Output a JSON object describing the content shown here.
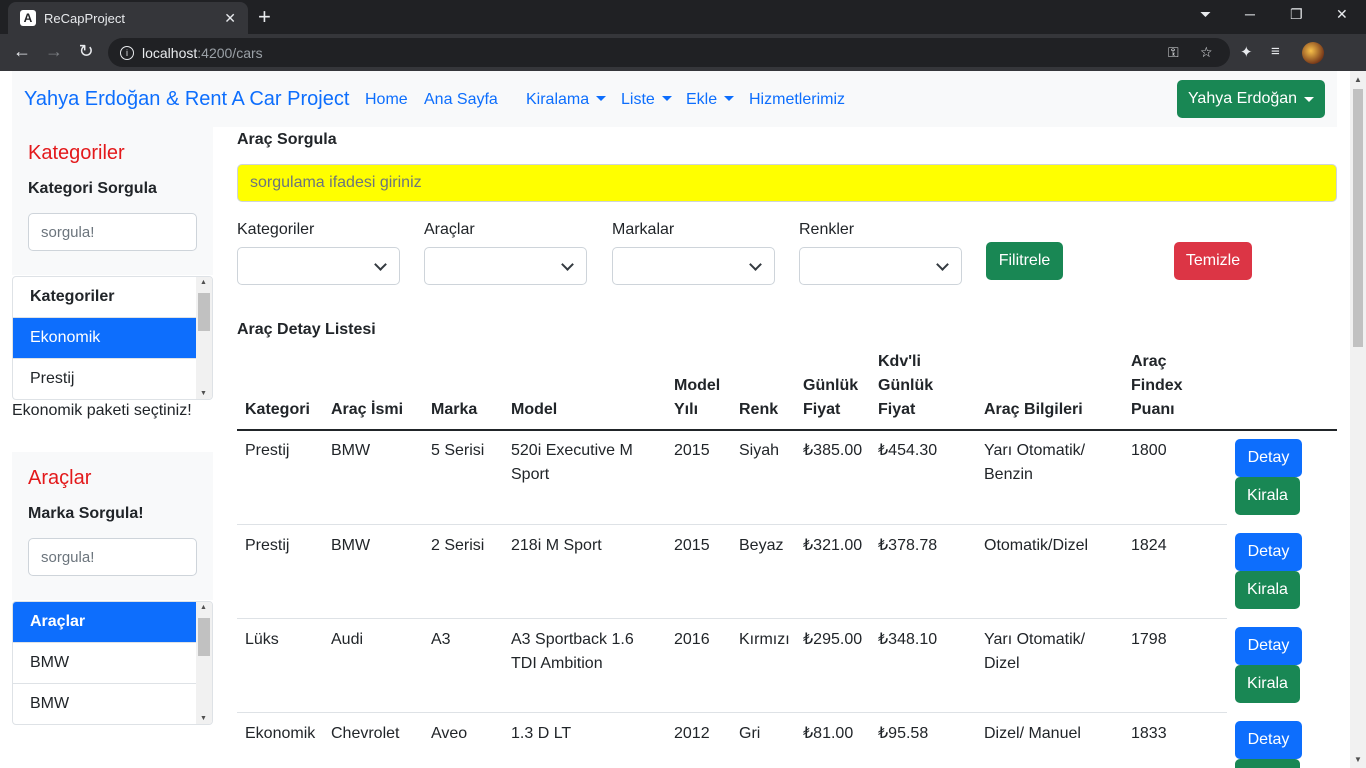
{
  "browser": {
    "tab_title": "ReCapProject",
    "url_host": "localhost",
    "url_path": ":4200/cars"
  },
  "navbar": {
    "brand": "Yahya Erdoğan & Rent A Car Project",
    "links": [
      "Home",
      "Ana Sayfa",
      "Kiralama",
      "Liste",
      "Ekle",
      "Hizmetlerimiz"
    ],
    "user_button": "Yahya Erdoğan"
  },
  "sidebar": {
    "categories": {
      "title": "Kategoriler",
      "search_label": "Kategori Sorgula",
      "search_placeholder": "sorgula!",
      "list_header": "Kategoriler",
      "items": [
        "Ekonomik",
        "Prestij"
      ],
      "selected_message": "Ekonomik paketi seçtiniz!"
    },
    "cars": {
      "title": "Araçlar",
      "search_label": "Marka Sorgula!",
      "search_placeholder": "sorgula!",
      "list_header": "Araçlar",
      "items": [
        "BMW",
        "BMW"
      ]
    }
  },
  "main": {
    "query_label": "Araç Sorgula",
    "query_placeholder": "sorgulama ifadesi giriniz",
    "filters": {
      "labels": [
        "Kategoriler",
        "Araçlar",
        "Markalar",
        "Renkler"
      ],
      "filter_button": "Filitrele",
      "clear_button": "Temizle"
    },
    "list_title": "Araç Detay Listesi",
    "table": {
      "headers": [
        [
          "Kategori"
        ],
        [
          "Araç İsmi"
        ],
        [
          "Marka"
        ],
        [
          "Model"
        ],
        [
          "Model",
          "Yılı"
        ],
        [
          "Renk"
        ],
        [
          "Günlük",
          "Fiyat"
        ],
        [
          "Kdv'li",
          "Günlük",
          "Fiyat"
        ],
        [
          "Araç Bilgileri"
        ],
        [
          "Araç",
          "Findex",
          "Puanı"
        ]
      ],
      "rows": [
        {
          "category": "Prestij",
          "name": "BMW",
          "brand": "5 Serisi",
          "model": [
            "520i Executive M",
            "Sport"
          ],
          "year": "2015",
          "color": "Siyah",
          "daily": "₺385.00",
          "daily_vat": "₺454.30",
          "info": [
            "Yarı Otomatik/",
            "Benzin"
          ],
          "findex": "1800"
        },
        {
          "category": "Prestij",
          "name": "BMW",
          "brand": "2 Serisi",
          "model": [
            "218i M Sport"
          ],
          "year": "2015",
          "color": "Beyaz",
          "daily": "₺321.00",
          "daily_vat": "₺378.78",
          "info": [
            "Otomatik/Dizel"
          ],
          "findex": "1824"
        },
        {
          "category": "Lüks",
          "name": "Audi",
          "brand": "A3",
          "model": [
            "A3 Sportback 1.6",
            "TDI Ambition"
          ],
          "year": "2016",
          "color": "Kırmızı",
          "daily": "₺295.00",
          "daily_vat": "₺348.10",
          "info": [
            "Yarı Otomatik/",
            "Dizel"
          ],
          "findex": "1798"
        },
        {
          "category": "Ekonomik",
          "name": "Chevrolet",
          "brand": "Aveo",
          "model": [
            "1.3 D LT"
          ],
          "year": "2012",
          "color": "Gri",
          "daily": "₺81.00",
          "daily_vat": "₺95.58",
          "info": [
            "Dizel/ Manuel"
          ],
          "findex": "1833"
        }
      ],
      "detail_button": "Detay",
      "rent_button": "Kirala"
    }
  },
  "colors": {
    "primary": "#0d6efd",
    "success": "#198754",
    "danger": "#dc3545",
    "search_bg": "#ffff00",
    "sidebar_title": "#e3191b"
  }
}
